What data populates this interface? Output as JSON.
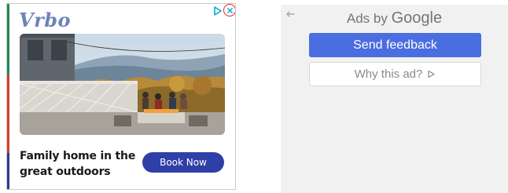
{
  "ad": {
    "brand": "Vrbo",
    "headline": "Family home in the great outdoors",
    "cta_label": "Book Now",
    "icons": {
      "adchoices": "adchoices-icon",
      "close": "close-icon"
    },
    "colors": {
      "cta": "#2f3fa8",
      "brand": "#6c84b8",
      "close_ring": "#e0242b"
    }
  },
  "feedback": {
    "ads_by": "Ads by",
    "google": "Google",
    "send_feedback_label": "Send feedback",
    "why_this_ad_label": "Why this ad?",
    "icons": {
      "back": "back-arrow-icon",
      "why": "adchoices-play-icon"
    },
    "colors": {
      "send_feedback": "#4a6ee0",
      "panel_bg": "#f1f1f1"
    }
  }
}
